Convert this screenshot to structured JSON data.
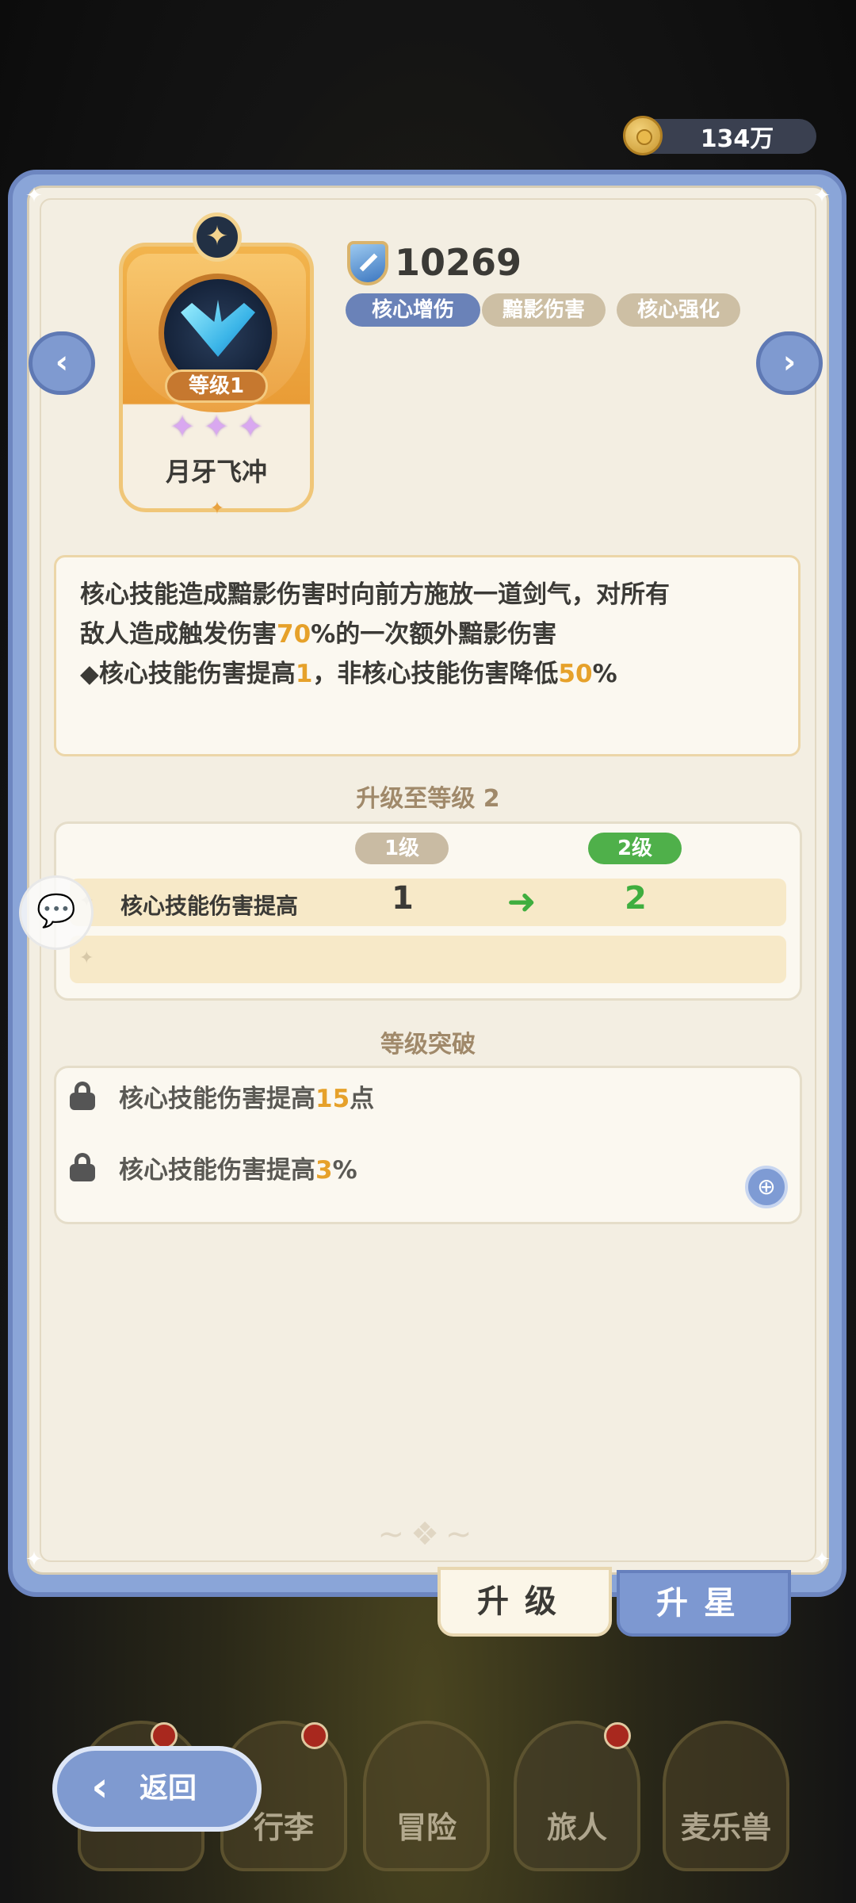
{
  "currency": {
    "value": "134万",
    "icon": "coin-icon"
  },
  "skill": {
    "level_label": "等级1",
    "name": "月牙飞冲",
    "stars": [
      "✦",
      "✦",
      "✦"
    ],
    "power": "10269",
    "tags": [
      "核心增伤",
      "黯影伤害",
      "核心强化"
    ]
  },
  "description": {
    "line1": "核心技能造成黯影伤害时向前方施放一道剑气，对所有",
    "line2_pre": "敌人造成触发伤害",
    "line2_hl": "70",
    "line2_post": "%的一次额外黯影伤害",
    "line3_pre": "◆核心技能伤害提高",
    "line3_hl1": "1",
    "line3_mid": "，非核心技能伤害降低",
    "line3_hl2": "50",
    "line3_post": "%"
  },
  "upgrade": {
    "title": "升级至等级 2",
    "from_level": "1级",
    "to_level": "2级",
    "stat_label": "核心技能伤害提高",
    "from_value": "1",
    "to_value": "2"
  },
  "breakthrough": {
    "title": "等级突破",
    "items": [
      {
        "pre": "核心技能伤害提高",
        "hl": "15",
        "post": "点"
      },
      {
        "pre": "核心技能伤害提高",
        "hl": "3",
        "post": "%"
      }
    ]
  },
  "tabs": {
    "upgrade": "升级",
    "star": "升星"
  },
  "bottom_nav": {
    "items": [
      "",
      "行李",
      "冒险",
      "旅人",
      "麦乐兽"
    ],
    "back": "返回"
  },
  "colors": {
    "accent_blue": "#7f9ad0",
    "highlight_orange": "#e6a12a",
    "green": "#3fae3f",
    "panel_bg": "#f3eee2"
  }
}
